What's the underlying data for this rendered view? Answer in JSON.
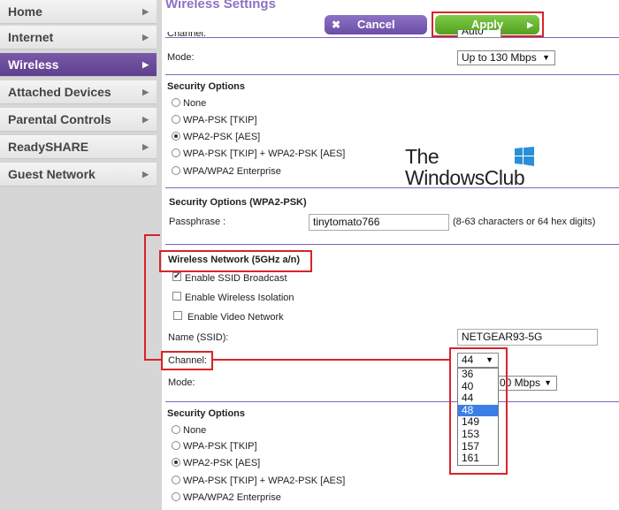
{
  "sidebar": {
    "items": [
      {
        "label": "Home",
        "active": false
      },
      {
        "label": "Internet",
        "active": false
      },
      {
        "label": "Wireless",
        "active": true
      },
      {
        "label": "Attached Devices",
        "active": false
      },
      {
        "label": "Parental Controls",
        "active": false
      },
      {
        "label": "ReadySHARE",
        "active": false
      },
      {
        "label": "Guest Network",
        "active": false
      }
    ]
  },
  "header": {
    "title": "Wireless Settings",
    "cancel_label": "Cancel",
    "apply_label": "Apply"
  },
  "network_24": {
    "channel_label": "Channel:",
    "channel_value": "Auto",
    "mode_label": "Mode:",
    "mode_value": "Up to 130 Mbps"
  },
  "security_24": {
    "title": "Security Options",
    "options": [
      "None",
      "WPA-PSK [TKIP]",
      "WPA2-PSK [AES]",
      "WPA-PSK [TKIP] + WPA2-PSK [AES]",
      "WPA/WPA2 Enterprise"
    ],
    "selected": "WPA2-PSK [AES]"
  },
  "security_wpa2": {
    "title": "Security Options (WPA2-PSK)",
    "passphrase_label": "Passphrase :",
    "passphrase_value": "tinytomato766",
    "hint": "(8-63 characters or 64 hex digits)"
  },
  "network_5g": {
    "title": "Wireless Network (5GHz a/n)",
    "enable_ssid_broadcast": "Enable SSID Broadcast",
    "enable_wireless_isolation": "Enable Wireless Isolation",
    "enable_video_network": "Enable Video Network",
    "ssid_label": "Name (SSID):",
    "ssid_value": "NETGEAR93-5G",
    "channel_label": "Channel:",
    "channel_value": "44",
    "channel_options": [
      "36",
      "40",
      "44",
      "48",
      "149",
      "153",
      "157",
      "161"
    ],
    "highlighted_option": "48",
    "mode_label": "Mode:",
    "mode_value_visible": "00 Mbps"
  },
  "security_5g": {
    "title": "Security Options",
    "options": [
      "None",
      "WPA-PSK [TKIP]",
      "WPA2-PSK [AES]",
      "WPA-PSK [TKIP] + WPA2-PSK [AES]",
      "WPA/WPA2 Enterprise"
    ],
    "selected": "WPA2-PSK [AES]"
  },
  "watermark": {
    "line1": "The",
    "line2": "WindowsClub"
  },
  "colors": {
    "accent_purple": "#7f66b8",
    "apply_green": "#5fb02a",
    "highlight_red": "#d8232a",
    "selected_blue": "#3a7ee6"
  }
}
